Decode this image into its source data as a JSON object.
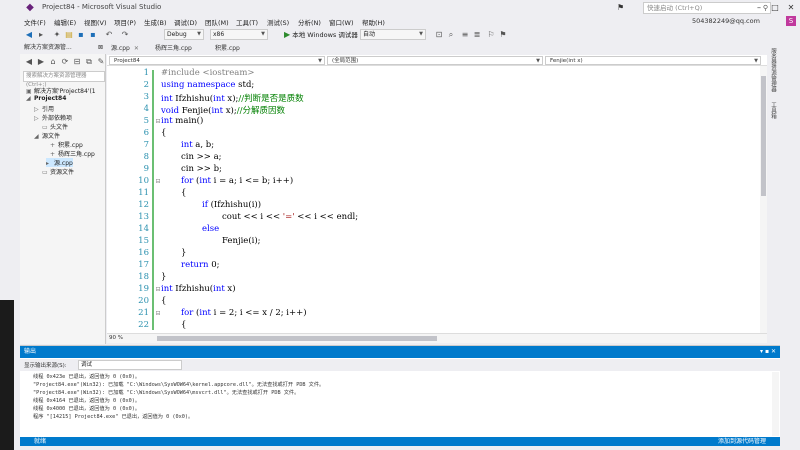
{
  "window": {
    "title": "Project84 - Microsoft Visual Studio",
    "quick_launch_placeholder": "快速启动 (Ctrl+Q)",
    "account": "504382249@qq.com",
    "account_badge": "S"
  },
  "menu": [
    "文件(F)",
    "编辑(E)",
    "视图(V)",
    "项目(P)",
    "生成(B)",
    "调试(D)",
    "团队(M)",
    "工具(T)",
    "测试(S)",
    "分析(N)",
    "窗口(W)",
    "帮助(H)"
  ],
  "toolbar": {
    "config": "Debug",
    "platform": "x86",
    "run_label": "本地 Windows 调试器",
    "run_mode": "自动"
  },
  "solution_explorer": {
    "title": "解决方案资源管...",
    "search_placeholder": "搜索解决方案资源管理器(Ctrl+;)",
    "items": [
      {
        "label": "解决方案'Project84'(1"
      },
      {
        "label": "Project84"
      },
      {
        "label": "引用"
      },
      {
        "label": "外部依赖项"
      },
      {
        "label": "头文件"
      },
      {
        "label": "源文件"
      },
      {
        "label": "积累.cpp"
      },
      {
        "label": "杨辉三角.cpp"
      },
      {
        "label": "源.cpp"
      },
      {
        "label": "资源文件"
      }
    ]
  },
  "tabs": [
    {
      "label": "源.cpp"
    },
    {
      "label": "杨辉三角.cpp"
    },
    {
      "label": "积累.cpp"
    }
  ],
  "nav": {
    "project": "Project84",
    "scope": "(全局范围)",
    "function": "Fenjie(int x)"
  },
  "code_lines": {
    "n1": "1",
    "n2": "2",
    "n3": "3",
    "n4": "4",
    "n5": "5",
    "n6": "6",
    "n7": "7",
    "n8": "8",
    "n9": "9",
    "n10": "10",
    "n11": "11",
    "n12": "12",
    "n13": "13",
    "n14": "14",
    "n15": "15",
    "n16": "16",
    "n17": "17",
    "n18": "18",
    "n19": "19",
    "n20": "20",
    "n21": "21",
    "n22": "22",
    "l1_pp": "#include <iostream>",
    "l2_kw": "using namespace",
    "l2_rest": " std;",
    "l3_kw": "int",
    "l3_rest": " Ifzhishu(",
    "l3_kw2": "int",
    "l3_rest2": " x);",
    "l3_cm": "//判断是否是质数",
    "l4_kw": "void",
    "l4_rest": " Fenjie(",
    "l4_kw2": "int",
    "l4_rest2": " x);",
    "l4_cm": "//分解质因数",
    "l5_kw": "int",
    "l5_rest": " main()",
    "l6": "{",
    "l7_kw": "int",
    "l7_rest": " a, b;",
    "l8": "cin >> a;",
    "l9": "cin >> b;",
    "l10_kw": "for",
    "l10_a": " (",
    "l10_kw2": "int",
    "l10_b": " i = a; i <= b; i++)",
    "l11": "{",
    "l12_kw": "if",
    "l12_rest": " (Ifzhishu(i))",
    "l13_a": "cout << i << ",
    "l13_s": "'='",
    "l13_b": " << i << endl;",
    "l14_kw": "else",
    "l15": "Fenjie(i);",
    "l16": "}",
    "l17_kw": "return",
    "l17_rest": " 0;",
    "l18": "}",
    "l19_kw": "int",
    "l19_rest": " Ifzhishu(",
    "l19_kw2": "int",
    "l19_rest2": " x)",
    "l20": "{",
    "l21_kw": "for",
    "l21_a": " (",
    "l21_kw2": "int",
    "l21_b": " i = 2; i <= x / 2; i++)",
    "l22": "{"
  },
  "editor": {
    "zoom": "90 %"
  },
  "right_strip": {
    "item1": "服务器资源管理器",
    "item2": "工具箱"
  },
  "output": {
    "title": "输出",
    "source_label": "显示输出来源(S):",
    "source_value": "调试",
    "lines": [
      "线程 0x423e 已退出，返回值为 0 (0x0)。",
      "\"Project84.exe\"(Win32): 已加载 \"C:\\Windows\\SysWOW64\\kernel.appcore.dll\"。无法查找或打开 PDB 文件。",
      "\"Project84.exe\"(Win32): 已加载 \"C:\\Windows\\SysWOW64\\msvcrt.dll\"。无法查找或打开 PDB 文件。",
      "线程 0x4164 已退出，返回值为 0 (0x0)。",
      "线程 0x4000 已退出，返回值为 0 (0x0)。",
      "程序 \"[14215] Project84.exe\" 已退出，返回值为 0 (0x0)。"
    ]
  },
  "status": {
    "left": "就绪",
    "right": "添加到源代码管理"
  }
}
